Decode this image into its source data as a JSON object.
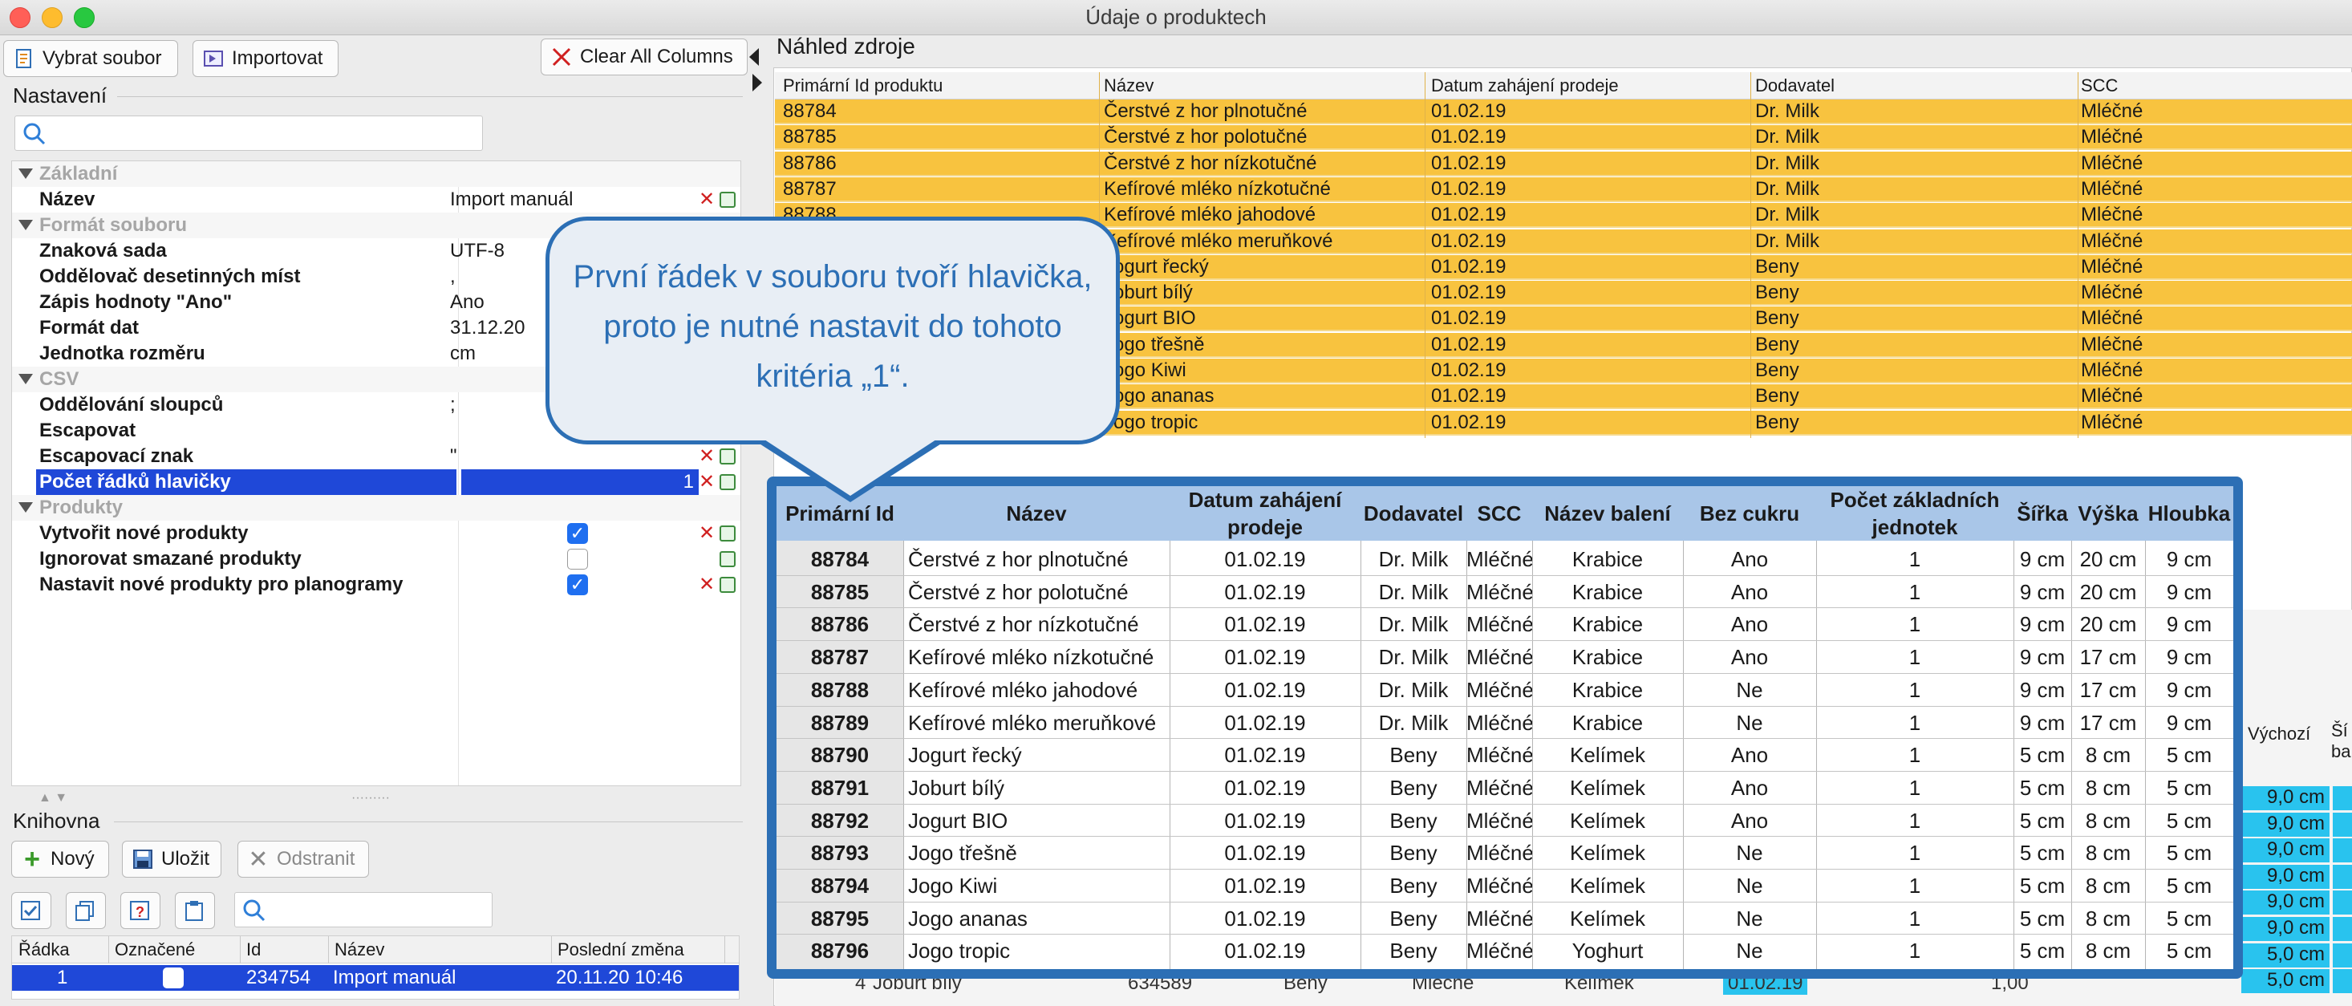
{
  "window": {
    "title": "Údaje o produktech"
  },
  "toolbar": {
    "select_file": "Vybrat soubor",
    "import": "Importovat",
    "clear_all": "Clear All Columns"
  },
  "settings": {
    "title": "Nastavení",
    "search_placeholder": "",
    "rows": [
      {
        "type": "category",
        "label": "Základní"
      },
      {
        "type": "prop",
        "label": "Název",
        "value": "Import manuál"
      },
      {
        "type": "category",
        "label": "Formát souboru"
      },
      {
        "type": "prop",
        "label": "Znaková sada",
        "value": "UTF-8"
      },
      {
        "type": "prop",
        "label": "Oddělovač desetinných míst",
        "value": ","
      },
      {
        "type": "prop",
        "label": "Zápis hodnoty \"Ano\"",
        "value": "Ano"
      },
      {
        "type": "prop",
        "label": "Formát dat",
        "value": "31.12.20"
      },
      {
        "type": "prop",
        "label": "Jednotka rozměru",
        "value": "cm"
      },
      {
        "type": "category",
        "label": "CSV"
      },
      {
        "type": "prop",
        "label": "Oddělování sloupců",
        "value": ";"
      },
      {
        "type": "prop",
        "label": "Escapovat",
        "value": ""
      },
      {
        "type": "prop",
        "label": "Escapovací znak",
        "value": "\""
      },
      {
        "type": "prop",
        "label": "Počet řádků hlavičky",
        "value": "1"
      },
      {
        "type": "category",
        "label": "Produkty"
      },
      {
        "type": "prop",
        "label": "Vytvořit nové produkty",
        "checked": true
      },
      {
        "type": "prop",
        "label": "Ignorovat smazané produkty",
        "checked": false
      },
      {
        "type": "prop",
        "label": "Nastavit nové produkty pro planogramy",
        "checked": true
      }
    ]
  },
  "library": {
    "title": "Knihovna",
    "new": "Nový",
    "save": "Uložit",
    "remove": "Odstranit",
    "columns": [
      "Řádka",
      "Označené",
      "Id",
      "Název",
      "Poslední změna"
    ],
    "row": {
      "line": "1",
      "id": "234754",
      "name": "Import manuál",
      "changed": "20.11.20 10:46"
    }
  },
  "source": {
    "title": "Náhled zdroje",
    "columns": [
      "Primární Id produktu",
      "Název",
      "Datum zahájení prodeje",
      "Dodavatel",
      "SCC"
    ],
    "rows": [
      [
        "88784",
        "Čerstvé z hor plnotučné",
        "01.02.19",
        "Dr. Milk",
        "Mléčné"
      ],
      [
        "88785",
        "Čerstvé z hor polotučné",
        "01.02.19",
        "Dr. Milk",
        "Mléčné"
      ],
      [
        "88786",
        "Čerstvé z hor nízkotučné",
        "01.02.19",
        "Dr. Milk",
        "Mléčné"
      ],
      [
        "88787",
        "Kefírové mléko nízkotučné",
        "01.02.19",
        "Dr. Milk",
        "Mléčné"
      ],
      [
        "88788",
        "Kefírové mléko jahodové",
        "01.02.19",
        "Dr. Milk",
        "Mléčné"
      ],
      [
        "88789",
        "Kefírové mléko meruňkové",
        "01.02.19",
        "Dr. Milk",
        "Mléčné"
      ],
      [
        "88790",
        "Jogurt řecký",
        "01.02.19",
        "Beny",
        "Mléčné"
      ],
      [
        "88791",
        "Joburt bílý",
        "01.02.19",
        "Beny",
        "Mléčné"
      ],
      [
        "88792",
        "Jogurt BIO",
        "01.02.19",
        "Beny",
        "Mléčné"
      ],
      [
        "88793",
        "Jogo třešně",
        "01.02.19",
        "Beny",
        "Mléčné"
      ],
      [
        "88794",
        "Jogo Kiwi",
        "01.02.19",
        "Beny",
        "Mléčné"
      ],
      [
        "88795",
        "Jogo ananas",
        "01.02.19",
        "Beny",
        "Mléčné"
      ],
      [
        "88796",
        "Jogo tropic",
        "01.02.19",
        "Beny",
        "Mléčné"
      ]
    ]
  },
  "background_lower": {
    "headers": [
      "Výchozí",
      "Ší",
      "ba"
    ],
    "cyan_values": [
      "9,0 cm",
      "9,0 cm",
      "9,0 cm",
      "9,0 cm",
      "9,0 cm",
      "9,0 cm",
      "5,0 cm",
      "5,0 cm"
    ],
    "bottom_row": [
      "4",
      "Joburt bílý",
      "634589",
      "Beny",
      "Mléčné",
      "Kelímek",
      "01.02.19",
      "1,00"
    ]
  },
  "overlay": {
    "columns": [
      "Primární Id",
      "Název",
      "Datum zahájení prodeje",
      "Dodavatel",
      "SCC",
      "Název balení",
      "Bez cukru",
      "Počet základních jednotek",
      "Šířka",
      "Výška",
      "Hloubka"
    ],
    "rows": [
      [
        "88784",
        "Čerstvé z hor plnotučné",
        "01.02.19",
        "Dr. Milk",
        "Mléčné",
        "Krabice",
        "Ano",
        "1",
        "9 cm",
        "20 cm",
        "9 cm"
      ],
      [
        "88785",
        "Čerstvé z hor polotučné",
        "01.02.19",
        "Dr. Milk",
        "Mléčné",
        "Krabice",
        "Ano",
        "1",
        "9 cm",
        "20 cm",
        "9 cm"
      ],
      [
        "88786",
        "Čerstvé z hor nízkotučné",
        "01.02.19",
        "Dr. Milk",
        "Mléčné",
        "Krabice",
        "Ano",
        "1",
        "9 cm",
        "20 cm",
        "9 cm"
      ],
      [
        "88787",
        "Kefírové mléko nízkotučné",
        "01.02.19",
        "Dr. Milk",
        "Mléčné",
        "Krabice",
        "Ano",
        "1",
        "9 cm",
        "17 cm",
        "9 cm"
      ],
      [
        "88788",
        "Kefírové mléko jahodové",
        "01.02.19",
        "Dr. Milk",
        "Mléčné",
        "Krabice",
        "Ne",
        "1",
        "9 cm",
        "17 cm",
        "9 cm"
      ],
      [
        "88789",
        "Kefírové mléko meruňkové",
        "01.02.19",
        "Dr. Milk",
        "Mléčné",
        "Krabice",
        "Ne",
        "1",
        "9 cm",
        "17 cm",
        "9 cm"
      ],
      [
        "88790",
        "Jogurt řecký",
        "01.02.19",
        "Beny",
        "Mléčné",
        "Kelímek",
        "Ano",
        "1",
        "5 cm",
        "8 cm",
        "5 cm"
      ],
      [
        "88791",
        "Joburt bílý",
        "01.02.19",
        "Beny",
        "Mléčné",
        "Kelímek",
        "Ano",
        "1",
        "5 cm",
        "8 cm",
        "5 cm"
      ],
      [
        "88792",
        "Jogurt BIO",
        "01.02.19",
        "Beny",
        "Mléčné",
        "Kelímek",
        "Ano",
        "1",
        "5 cm",
        "8 cm",
        "5 cm"
      ],
      [
        "88793",
        "Jogo třešně",
        "01.02.19",
        "Beny",
        "Mléčné",
        "Kelímek",
        "Ne",
        "1",
        "5 cm",
        "8 cm",
        "5 cm"
      ],
      [
        "88794",
        "Jogo Kiwi",
        "01.02.19",
        "Beny",
        "Mléčné",
        "Kelímek",
        "Ne",
        "1",
        "5 cm",
        "8 cm",
        "5 cm"
      ],
      [
        "88795",
        "Jogo ananas",
        "01.02.19",
        "Beny",
        "Mléčné",
        "Kelímek",
        "Ne",
        "1",
        "5 cm",
        "8 cm",
        "5 cm"
      ],
      [
        "88796",
        "Jogo tropic",
        "01.02.19",
        "Beny",
        "Mléčné",
        "Yoghurt",
        "Ne",
        "1",
        "5 cm",
        "8 cm",
        "5 cm"
      ]
    ]
  },
  "callout": {
    "text": "První řádek v souboru tvoří hlavička, proto je nutné nastavit do tohoto kritéria „1“."
  },
  "colors": {
    "highlight_row": "#f8c33f",
    "selection": "#1f48d8",
    "callout_border": "#2c6fb5",
    "cyan_cell": "#29c3ee"
  }
}
